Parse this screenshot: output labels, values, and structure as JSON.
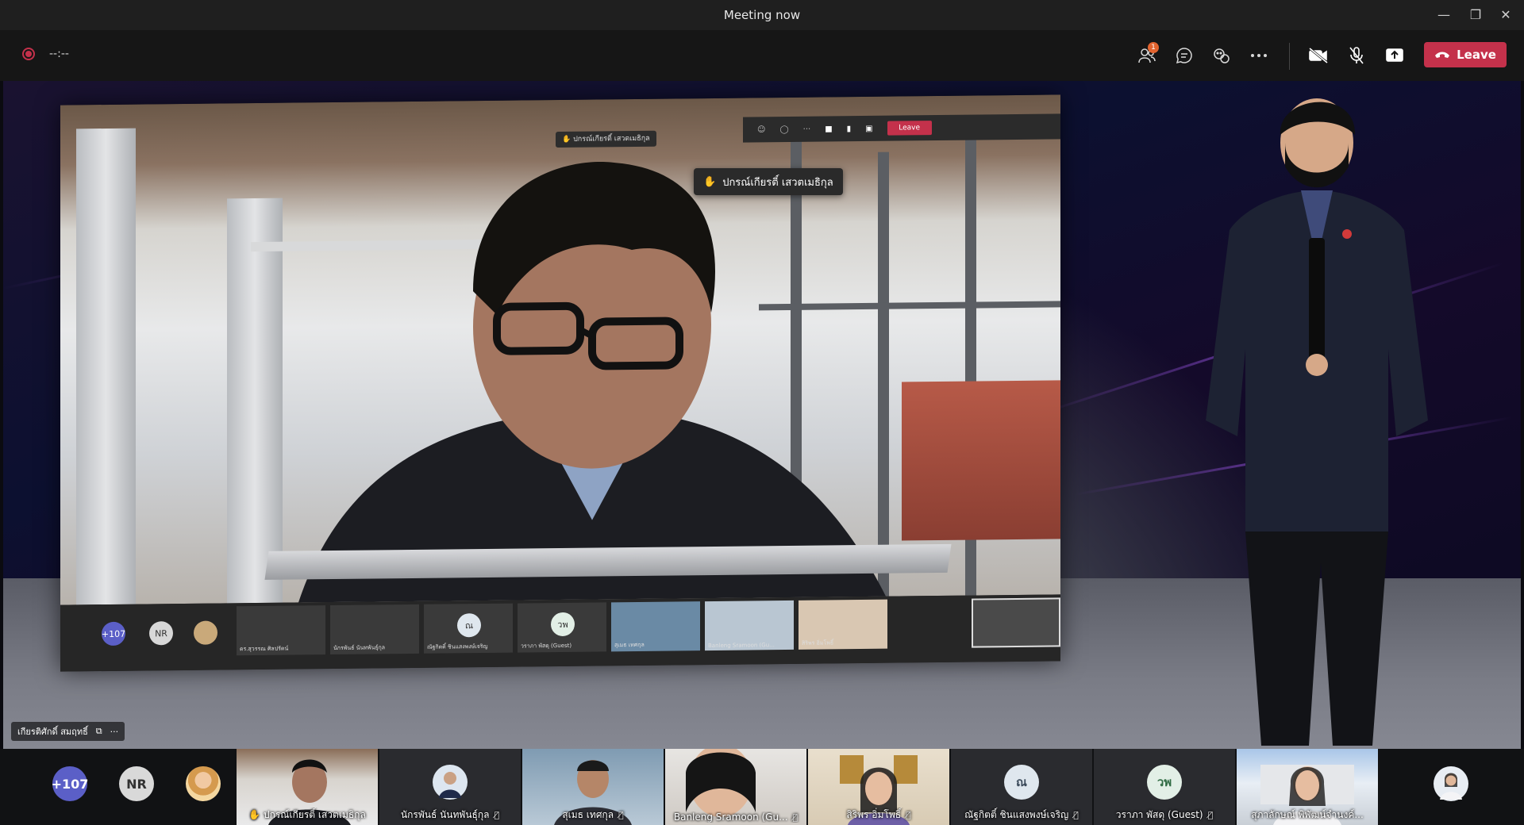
{
  "window": {
    "title": "Meeting now",
    "minimize": "—",
    "restore": "❐",
    "close": "✕"
  },
  "toolbar": {
    "timer": "--:--",
    "participants_badge": "1",
    "leave_label": "Leave"
  },
  "stage": {
    "hand_notice": "ปกรณ์เกียรติ์ เสวตเมธิกุล",
    "inner_hand_notice": "ปกรณ์เกียรติ์ เสวตเมธิกุล",
    "inner_leave": "Leave",
    "inner_overflow": "+107",
    "inner_initials": "NR",
    "inner_tiles": [
      "ดร.สุวรรณ ศิลปรัตน์",
      "นักรพันธ์ นันทพันธุ์กุล",
      "ณัฐกิตติ์ ชินแสงพงษ์เจริญ",
      "วราภา พัสดุ (Guest)",
      "สุเมธ เทศกุล",
      "Banleng Sramoon (Gu...",
      "สิริพร อิ่มโพธิ์"
    ],
    "inner_avatars": [
      "ณ",
      "วพ"
    ],
    "label_name": "เกียรติศักดิ์ สมฤทธิ์",
    "label_more": "···"
  },
  "strip": {
    "overflow": "+107",
    "initials_nr": "NR",
    "tiles": [
      {
        "name": "ปกรณ์เกียรติ์ เสวตเมธิกุล",
        "hand": "✋"
      },
      {
        "name": "นักรพันธ์ นันทพันธุ์กุล"
      },
      {
        "name": "สุเมธ เทศกุล"
      },
      {
        "name": "Banleng Sramoon (Gu..."
      },
      {
        "name": "สิริพร อิ่มโพธิ์"
      },
      {
        "name": "ณัฐกิตติ์ ชินแสงพงษ์เจริญ",
        "initials": "ณ"
      },
      {
        "name": "วราภา พัสดุ (Guest)",
        "initials": "วพ"
      },
      {
        "name": "สุภาลักษณ์ พิพัฒน์จำนงค์..."
      }
    ]
  },
  "colors": {
    "leave": "#c4314b",
    "badge": "#e3642f",
    "overflow_avatar": "#5b5fc7"
  }
}
